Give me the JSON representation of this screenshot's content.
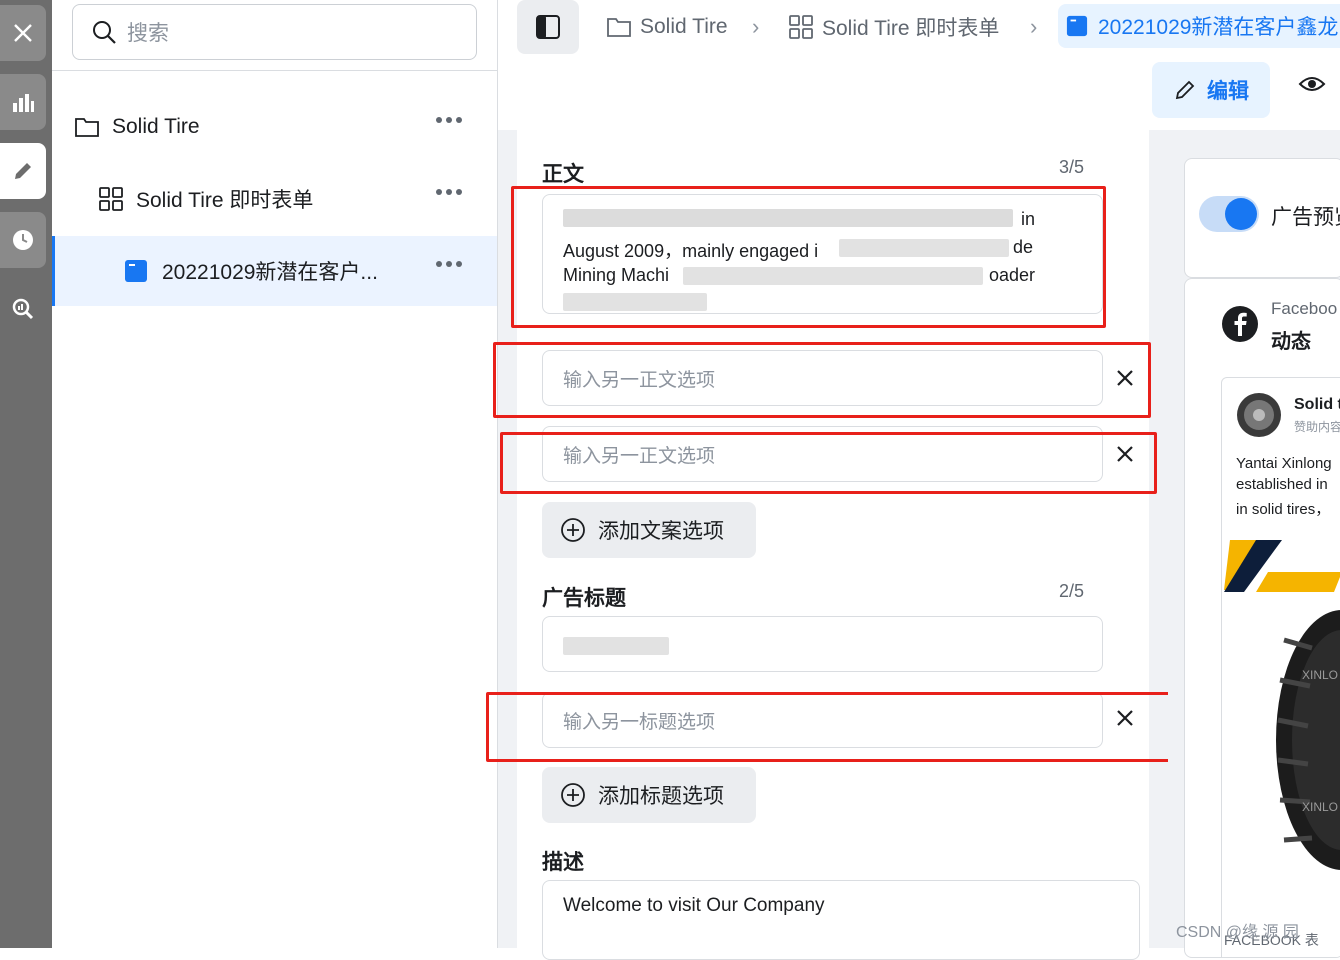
{
  "rail": {
    "icons": [
      "close-icon",
      "chart-icon",
      "pencil-icon",
      "clock-icon",
      "magnify-chart-icon"
    ]
  },
  "sidebar": {
    "search_placeholder": "搜索",
    "items": [
      {
        "label": "Solid Tire",
        "icon": "folder-icon"
      },
      {
        "label": "Solid Tire 即时表单",
        "icon": "grid-icon"
      },
      {
        "label": "20221029新潜在客户...",
        "icon": "form-icon"
      }
    ]
  },
  "breadcrumb": {
    "items": [
      "Solid Tire",
      "Solid Tire 即时表单"
    ],
    "current": "20221029新潜在客户鑫龙"
  },
  "toolbar": {
    "edit_label": "编辑"
  },
  "form": {
    "body": {
      "title": "正文",
      "count": "3/5",
      "text_lines": [
        "in",
        "August 2009，mainly engaged i",
        "de",
        "Mining Machi",
        "oader"
      ],
      "extra_placeholder_1": "输入另一正文选项",
      "extra_placeholder_2": "输入另一正文选项",
      "add_label": "添加文案选项"
    },
    "headline": {
      "title": "广告标题",
      "count": "2/5",
      "extra_placeholder": "输入另一标题选项",
      "add_label": "添加标题选项"
    },
    "description": {
      "title": "描述",
      "value": "Welcome to visit Our Company"
    }
  },
  "preview": {
    "toggle_label": "广告预览",
    "platform_name": "Faceboo",
    "placement": "动态",
    "page_name": "Solid t",
    "sponsored": "赞助内容",
    "post_text": [
      "Yantai Xinlong",
      "established in",
      "in solid tires，"
    ],
    "tire_brand": "XINLO",
    "footer": "FACEBOOK 表"
  },
  "watermark": "CSDN @缘 源 园",
  "colors": {
    "accent": "#1877f2",
    "highlight_frame": "#e8201a",
    "rail": "#6d6d6d"
  }
}
